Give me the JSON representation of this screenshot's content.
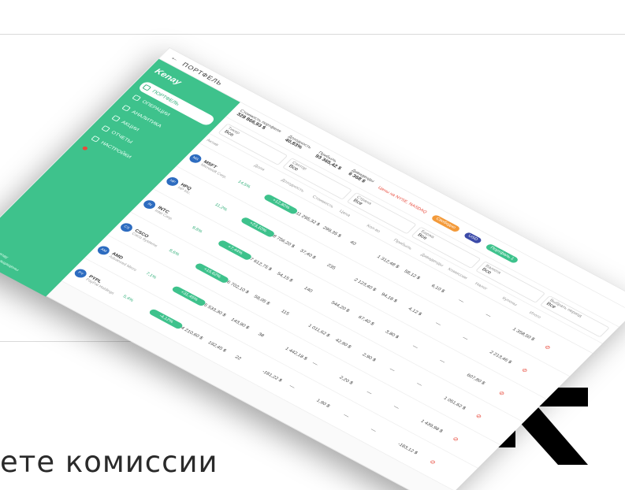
{
  "background": {
    "letter": "и",
    "caption": "ете комиссии"
  },
  "app": {
    "back_icon": "arrow-left-icon",
    "title": "ПОРТФЕЛЬ",
    "logo": "Kenay",
    "nav": [
      {
        "label": "ПОРТФЕЛЬ",
        "icon": "briefcase-icon",
        "active": true
      },
      {
        "label": "ОПЕРАЦИИ",
        "icon": "refresh-icon",
        "active": false
      },
      {
        "label": "АНАЛИТИКА",
        "icon": "chart-icon",
        "active": false
      },
      {
        "label": "АКЦИИ",
        "icon": "star-icon",
        "active": false
      },
      {
        "label": "ОТЧЕТЫ",
        "icon": "report-icon",
        "active": false
      },
      {
        "label": "НАСТРОЙКИ",
        "icon": "gear-icon",
        "active": false
      },
      {
        "label": "",
        "icon": "alert-dot-icon",
        "active": false
      }
    ],
    "sidebar_footer": [
      "© 2021 Kenay",
      "Все права защищены"
    ],
    "topbar": {
      "metrics": [
        {
          "label": "Стоимость портфеля",
          "value": "328 866,93 $"
        },
        {
          "label": "Доходность",
          "value": "40,83%"
        },
        {
          "label": "Прибыль",
          "value": "93 365,42 $"
        },
        {
          "label": "Дивиденды",
          "value": "6 368 $"
        }
      ],
      "notice": "Цены на NYSE, NASDAQ",
      "chips": [
        "Свободно",
        "USD",
        "Портфель 1"
      ]
    },
    "filters": [
      {
        "label": "Тикер",
        "value": "Все"
      },
      {
        "label": "Сектор",
        "value": "Все"
      },
      {
        "label": "Страна",
        "value": "Все"
      },
      {
        "label": "Биржа",
        "value": "Все"
      },
      {
        "label": "Валюта",
        "value": "Все"
      },
      {
        "label": "Выбрать период",
        "value": "Все"
      }
    ],
    "table": {
      "headers": [
        "Актив",
        "Доля",
        "Доходность",
        "Стоимость",
        "Цена",
        "Кол-во",
        "Прибыль",
        "Дивиденды",
        "Комиссии",
        "Налог",
        "Купоны",
        "Итого",
        ""
      ],
      "rows": [
        {
          "ticker": "MSFT",
          "name": "Microsoft Corp.",
          "share": "14,5%",
          "yield": "+12,80%",
          "value": "11 295,32 $",
          "price": "299,35 $",
          "qty": "40",
          "profit": "1 312,48 $",
          "div": "58,12 $",
          "fee": "6,10 $",
          "tax": "—",
          "coupon": "—",
          "total": "1 358,50 $"
        },
        {
          "ticker": "HPQ",
          "name": "HP Inc.",
          "share": "11,2%",
          "yield": "+23,10%",
          "value": "8 756,20 $",
          "price": "37,40 $",
          "qty": "235",
          "profit": "2 123,40 $",
          "div": "94,18 $",
          "fee": "4,12 $",
          "tax": "—",
          "coupon": "—",
          "total": "2 213,46 $"
        },
        {
          "ticker": "INTC",
          "name": "Intel Corp.",
          "share": "9,8%",
          "yield": "+7,44%",
          "value": "7 612,75 $",
          "price": "54,15 $",
          "qty": "140",
          "profit": "544,20 $",
          "div": "67,40 $",
          "fee": "3,80 $",
          "tax": "—",
          "coupon": "—",
          "total": "607,80 $"
        },
        {
          "ticker": "CSCO",
          "name": "Cisco Systems",
          "share": "8,6%",
          "yield": "+15,62%",
          "value": "6 702,10 $",
          "price": "58,05 $",
          "qty": "115",
          "profit": "1 011,62 $",
          "div": "42,90 $",
          "fee": "2,90 $",
          "tax": "—",
          "coupon": "—",
          "total": "1 051,62 $"
        },
        {
          "ticker": "AMD",
          "name": "Advanced Micro",
          "share": "7,1%",
          "yield": "+31,45%",
          "value": "5 533,30 $",
          "price": "143,90 $",
          "qty": "38",
          "profit": "1 442,18 $",
          "div": "—",
          "fee": "2,20 $",
          "tax": "—",
          "coupon": "—",
          "total": "1 439,98 $"
        },
        {
          "ticker": "PYPL",
          "name": "PayPal Holdings",
          "share": "5,4%",
          "yield": "-4,12%",
          "value": "4 210,60 $",
          "price": "192,45 $",
          "qty": "22",
          "profit": "-181,22 $",
          "div": "—",
          "fee": "1,90 $",
          "tax": "—",
          "coupon": "—",
          "total": "-183,12 $"
        }
      ]
    }
  },
  "colors": {
    "accent": "#3ec28c",
    "danger": "#e8493b",
    "navy": "#3b4aa8",
    "orange": "#f39a3a"
  }
}
